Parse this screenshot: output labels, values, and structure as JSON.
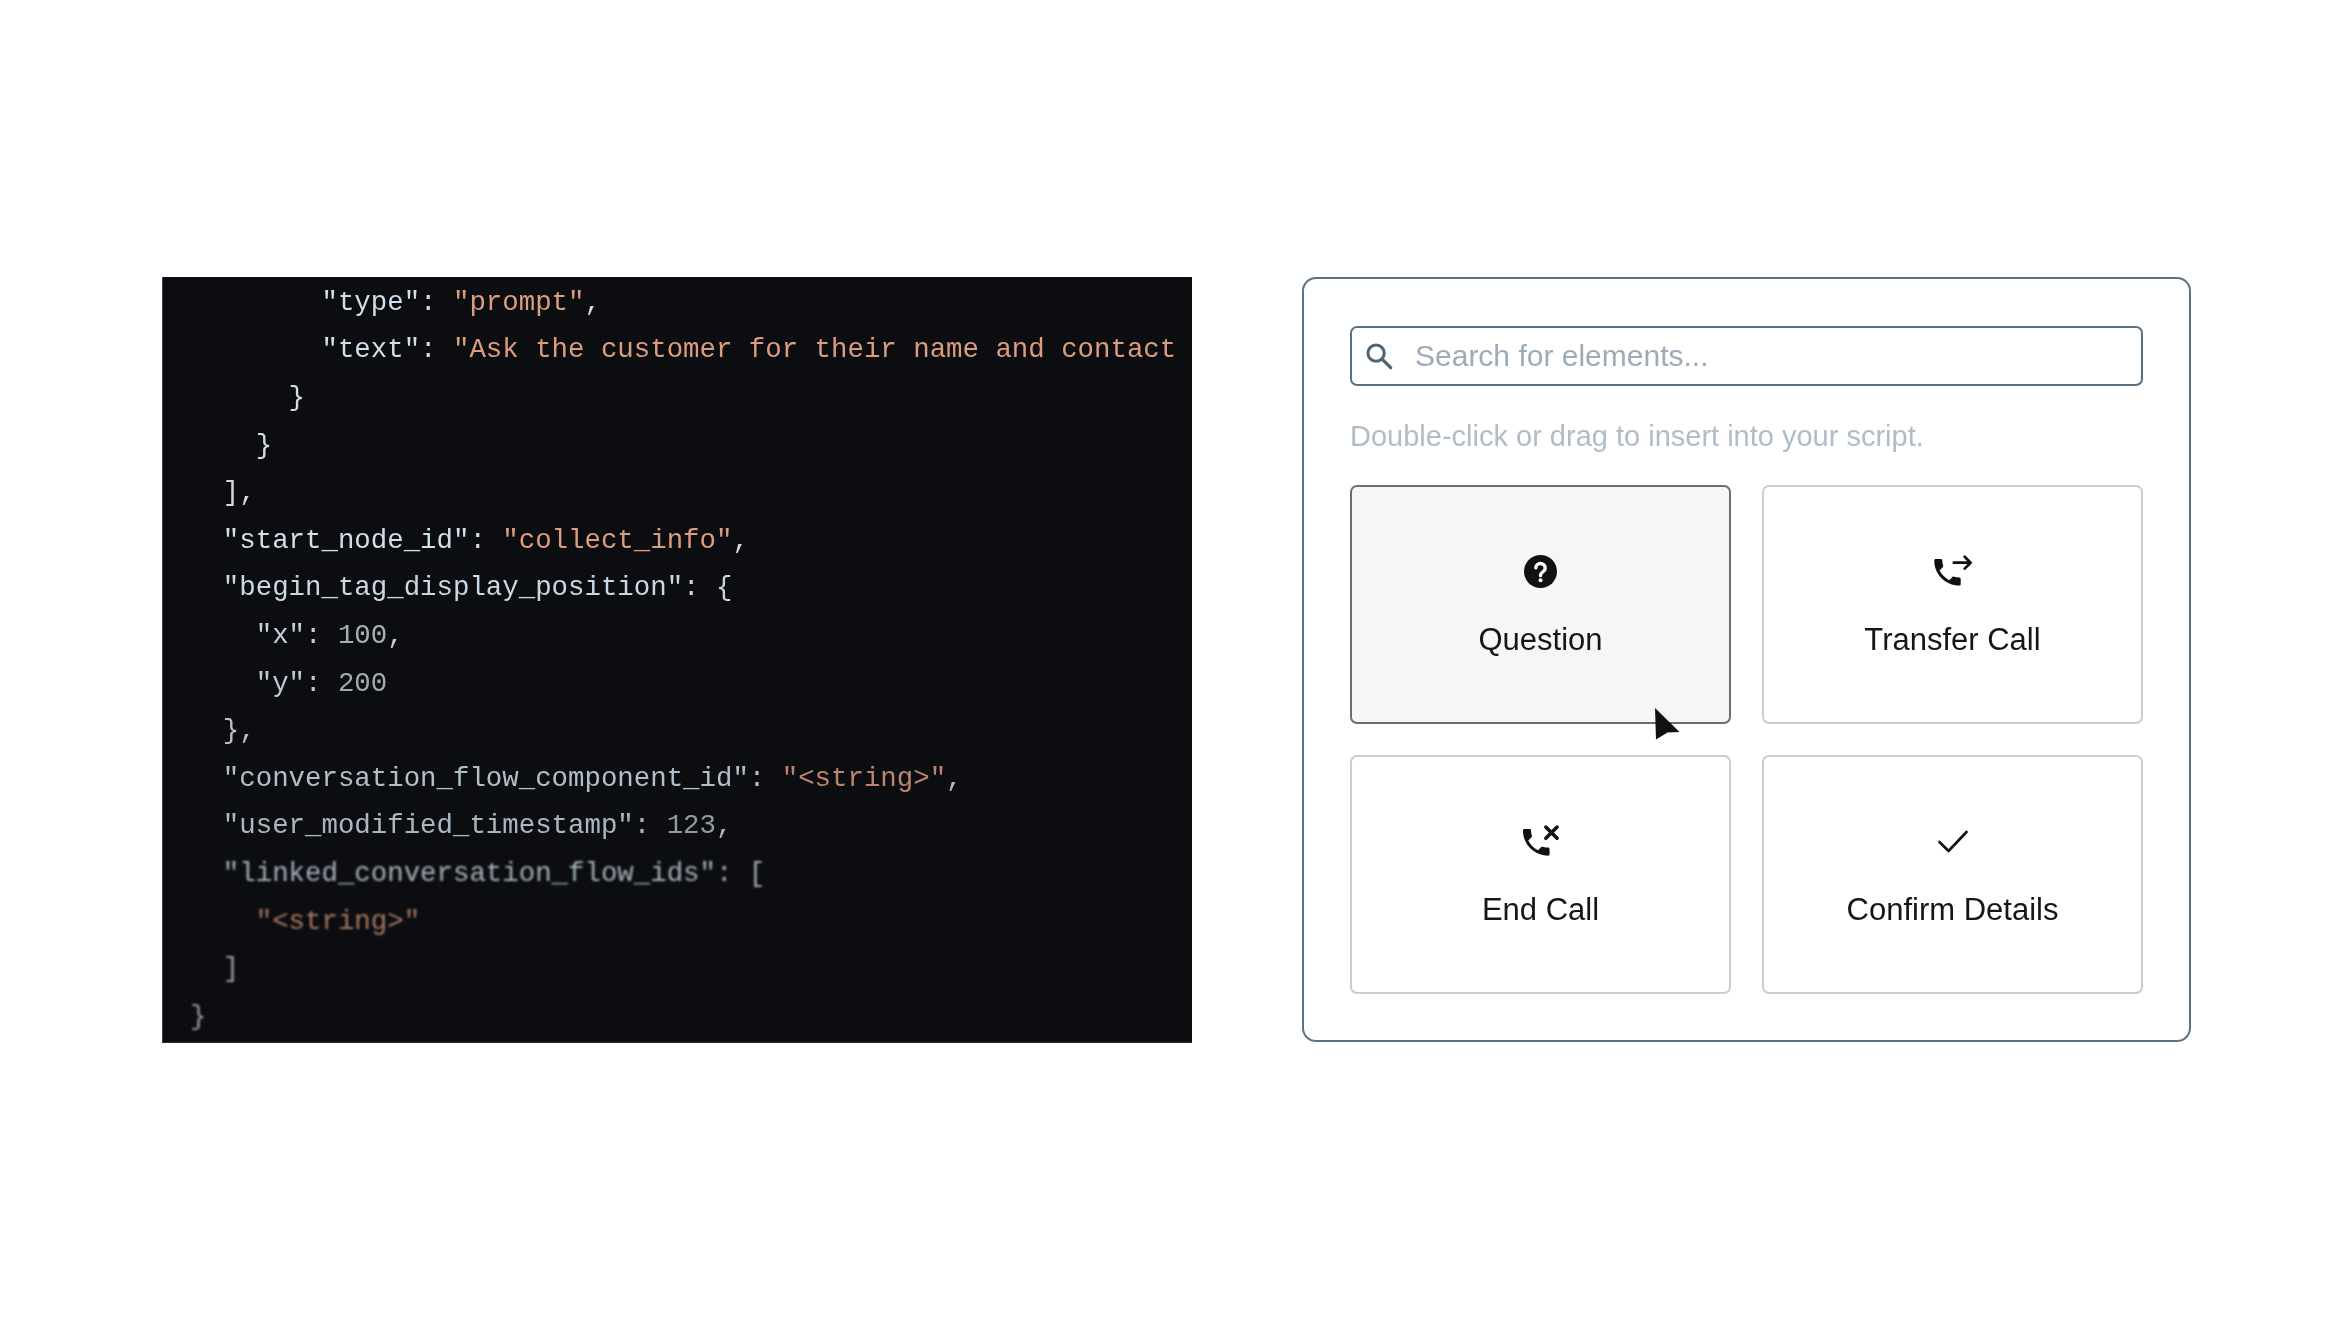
{
  "code_view": {
    "lines": [
      {
        "children": [
          {
            "children": [
              {
                "children": [
                  {
                    "children": [
                      {
                        "tokens": [
                          {
                            "kind": "key",
                            "text": "\"type\""
                          },
                          {
                            "kind": "punct",
                            "text": ": "
                          },
                          {
                            "kind": "string",
                            "text": "\"prompt\""
                          },
                          {
                            "kind": "punct",
                            "text": ","
                          }
                        ]
                      },
                      {
                        "tokens": [
                          {
                            "kind": "key",
                            "text": "\"text\""
                          },
                          {
                            "kind": "punct",
                            "text": ": "
                          },
                          {
                            "kind": "string",
                            "text": "\"Ask the customer for their name and contact"
                          }
                        ]
                      }
                    ]
                  },
                  {
                    "tokens": [
                      {
                        "kind": "punct",
                        "text": "}"
                      }
                    ]
                  }
                ]
              },
              {
                "tokens": [
                  {
                    "kind": "punct",
                    "text": "}"
                  }
                ]
              }
            ]
          },
          {
            "tokens": [
              {
                "kind": "punct",
                "text": "],"
              }
            ]
          },
          {
            "tokens": [
              {
                "kind": "key",
                "text": "\"start_node_id\""
              },
              {
                "kind": "punct",
                "text": ": "
              },
              {
                "kind": "string",
                "text": "\"collect_info\""
              },
              {
                "kind": "punct",
                "text": ","
              }
            ]
          },
          {
            "tokens": [
              {
                "kind": "key",
                "text": "\"begin_tag_display_position\""
              },
              {
                "kind": "punct",
                "text": ": {"
              }
            ],
            "children": [
              {
                "tokens": [
                  {
                    "kind": "key",
                    "text": "\"x\""
                  },
                  {
                    "kind": "punct",
                    "text": ": "
                  },
                  {
                    "kind": "number",
                    "text": "100"
                  },
                  {
                    "kind": "punct",
                    "text": ","
                  }
                ]
              },
              {
                "tokens": [
                  {
                    "kind": "key",
                    "text": "\"y\""
                  },
                  {
                    "kind": "punct",
                    "text": ": "
                  },
                  {
                    "kind": "number",
                    "text": "200"
                  }
                ]
              }
            ]
          },
          {
            "tokens": [
              {
                "kind": "punct",
                "text": "},"
              }
            ]
          },
          {
            "tokens": [
              {
                "kind": "key",
                "text": "\"conversation_flow_component_id\""
              },
              {
                "kind": "punct",
                "text": ": "
              },
              {
                "kind": "string",
                "text": "\"<string>\""
              },
              {
                "kind": "punct",
                "text": ","
              }
            ]
          },
          {
            "tokens": [
              {
                "kind": "key",
                "text": "\"user_modified_timestamp\""
              },
              {
                "kind": "punct",
                "text": ": "
              },
              {
                "kind": "number",
                "text": "123"
              },
              {
                "kind": "punct",
                "text": ","
              }
            ]
          },
          {
            "tokens": [
              {
                "kind": "key",
                "text": "\"linked_conversation_flow_ids\""
              },
              {
                "kind": "punct",
                "text": ": ["
              }
            ],
            "children": [
              {
                "tokens": [
                  {
                    "kind": "string",
                    "text": "\"<string>\""
                  }
                ]
              }
            ]
          },
          {
            "tokens": [
              {
                "kind": "punct",
                "text": "]"
              }
            ]
          }
        ]
      },
      {
        "tokens": [
          {
            "kind": "punct",
            "text": "}"
          }
        ]
      }
    ]
  },
  "element_picker": {
    "search": {
      "placeholder": "Search for elements..."
    },
    "hint": "Double-click or drag to insert into your script.",
    "elements": [
      {
        "kind": "question",
        "label": "Question",
        "selected": true
      },
      {
        "kind": "transfer",
        "label": "Transfer Call",
        "selected": false
      },
      {
        "kind": "hangup",
        "label": "End Call",
        "selected": false
      },
      {
        "kind": "confirm",
        "label": "Confirm Details",
        "selected": false
      }
    ]
  }
}
